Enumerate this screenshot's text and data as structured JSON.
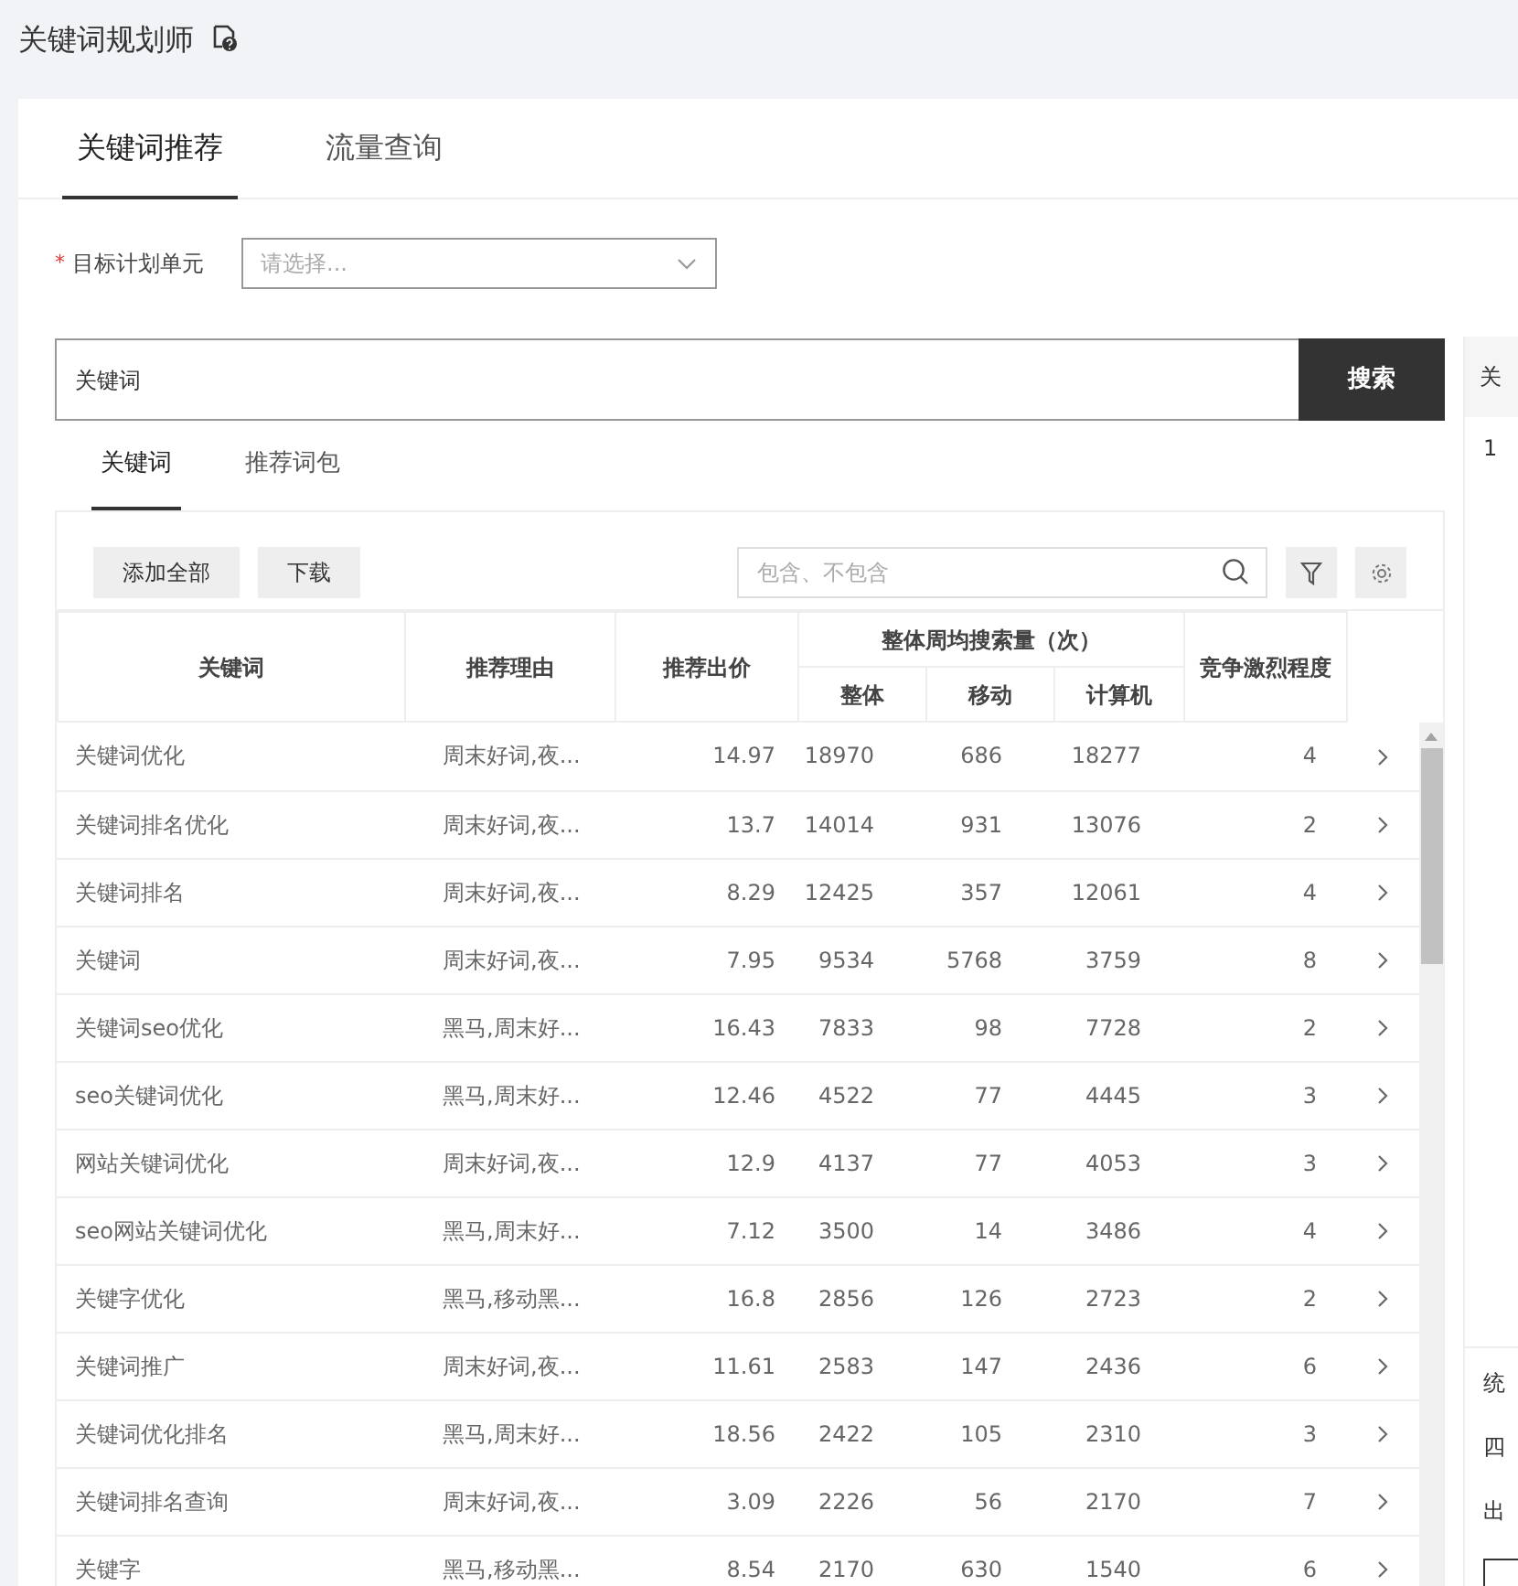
{
  "header": {
    "title": "关键词规划师"
  },
  "tabs": [
    {
      "label": "关键词推荐",
      "selected": true
    },
    {
      "label": "流量查询",
      "selected": false
    }
  ],
  "plan_unit": {
    "required_mark": "*",
    "label": "目标计划单元",
    "placeholder": "请选择..."
  },
  "search": {
    "value": "关键词",
    "button": "搜索"
  },
  "sub_tabs": [
    {
      "label": "关键词",
      "selected": true
    },
    {
      "label": "推荐词包",
      "selected": false
    }
  ],
  "toolbar": {
    "buttons": [
      "添加全部",
      "下载"
    ],
    "filter_placeholder": "包含、不包含"
  },
  "table": {
    "columns": [
      {
        "label": "关键词"
      },
      {
        "label": "推荐理由"
      },
      {
        "label": "推荐出价"
      },
      {
        "label": "整体周均搜索量（次）",
        "colspan": 3,
        "children": [
          "整体",
          "移动",
          "计算机"
        ]
      },
      {
        "label": "竞争激烈程度"
      }
    ],
    "rows": [
      [
        "关键词优化",
        "周末好词,夜...",
        "14.97",
        "18970",
        "686",
        "18277",
        "4"
      ],
      [
        "关键词排名优化",
        "周末好词,夜...",
        "13.7",
        "14014",
        "931",
        "13076",
        "2"
      ],
      [
        "关键词排名",
        "周末好词,夜...",
        "8.29",
        "12425",
        "357",
        "12061",
        "4"
      ],
      [
        "关键词",
        "周末好词,夜...",
        "7.95",
        "9534",
        "5768",
        "3759",
        "8"
      ],
      [
        "关键词seo优化",
        "黑马,周末好...",
        "16.43",
        "7833",
        "98",
        "7728",
        "2"
      ],
      [
        "seo关键词优化",
        "黑马,周末好...",
        "12.46",
        "4522",
        "77",
        "4445",
        "3"
      ],
      [
        "网站关键词优化",
        "周末好词,夜...",
        "12.9",
        "4137",
        "77",
        "4053",
        "3"
      ],
      [
        "seo网站关键词优化",
        "黑马,周末好...",
        "7.12",
        "3500",
        "14",
        "3486",
        "4"
      ],
      [
        "关键字优化",
        "黑马,移动黑...",
        "16.8",
        "2856",
        "126",
        "2723",
        "2"
      ],
      [
        "关键词推广",
        "周末好词,夜...",
        "11.61",
        "2583",
        "147",
        "2436",
        "6"
      ],
      [
        "关键词优化排名",
        "黑马,周末好...",
        "18.56",
        "2422",
        "105",
        "2310",
        "3"
      ],
      [
        "关键词排名查询",
        "周末好词,夜...",
        "3.09",
        "2226",
        "56",
        "2170",
        "7"
      ],
      [
        "关键字",
        "黑马,移动黑...",
        "8.54",
        "2170",
        "630",
        "1540",
        "6"
      ]
    ]
  },
  "side_panel": {
    "header": "关",
    "first_row": "1",
    "lines": [
      "统",
      "四",
      "出"
    ]
  }
}
